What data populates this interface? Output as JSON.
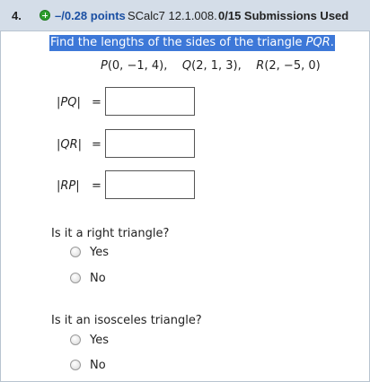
{
  "header": {
    "number": "4.",
    "points": "–/0.28 points",
    "source": "SCalc7 12.1.008.",
    "submissions": "0/15 Submissions Used"
  },
  "question": {
    "text_prefix": "Find the lengths of the sides of the triangle ",
    "text_var": "PQR",
    "text_suffix": ".",
    "p_name": "P",
    "p_coords": "(0, −1, 4),",
    "q_name": "Q",
    "q_coords": "(2, 1, 3),",
    "r_name": "R",
    "r_coords": "(2, −5, 0)"
  },
  "answers": [
    {
      "label": "PQ",
      "value": ""
    },
    {
      "label": "QR",
      "value": ""
    },
    {
      "label": "RP",
      "value": ""
    }
  ],
  "answer_eq": "=",
  "right_triangle": {
    "question": "Is it a right triangle?",
    "options": [
      "Yes",
      "No"
    ]
  },
  "isosceles": {
    "question": "Is it an isosceles triangle?",
    "options": [
      "Yes",
      "No"
    ]
  },
  "colors": {
    "header_bg": "#d4dde8",
    "points": "#1a4fa3",
    "highlight": "#3d78d8",
    "plus_icon": "#2e9e2e"
  }
}
